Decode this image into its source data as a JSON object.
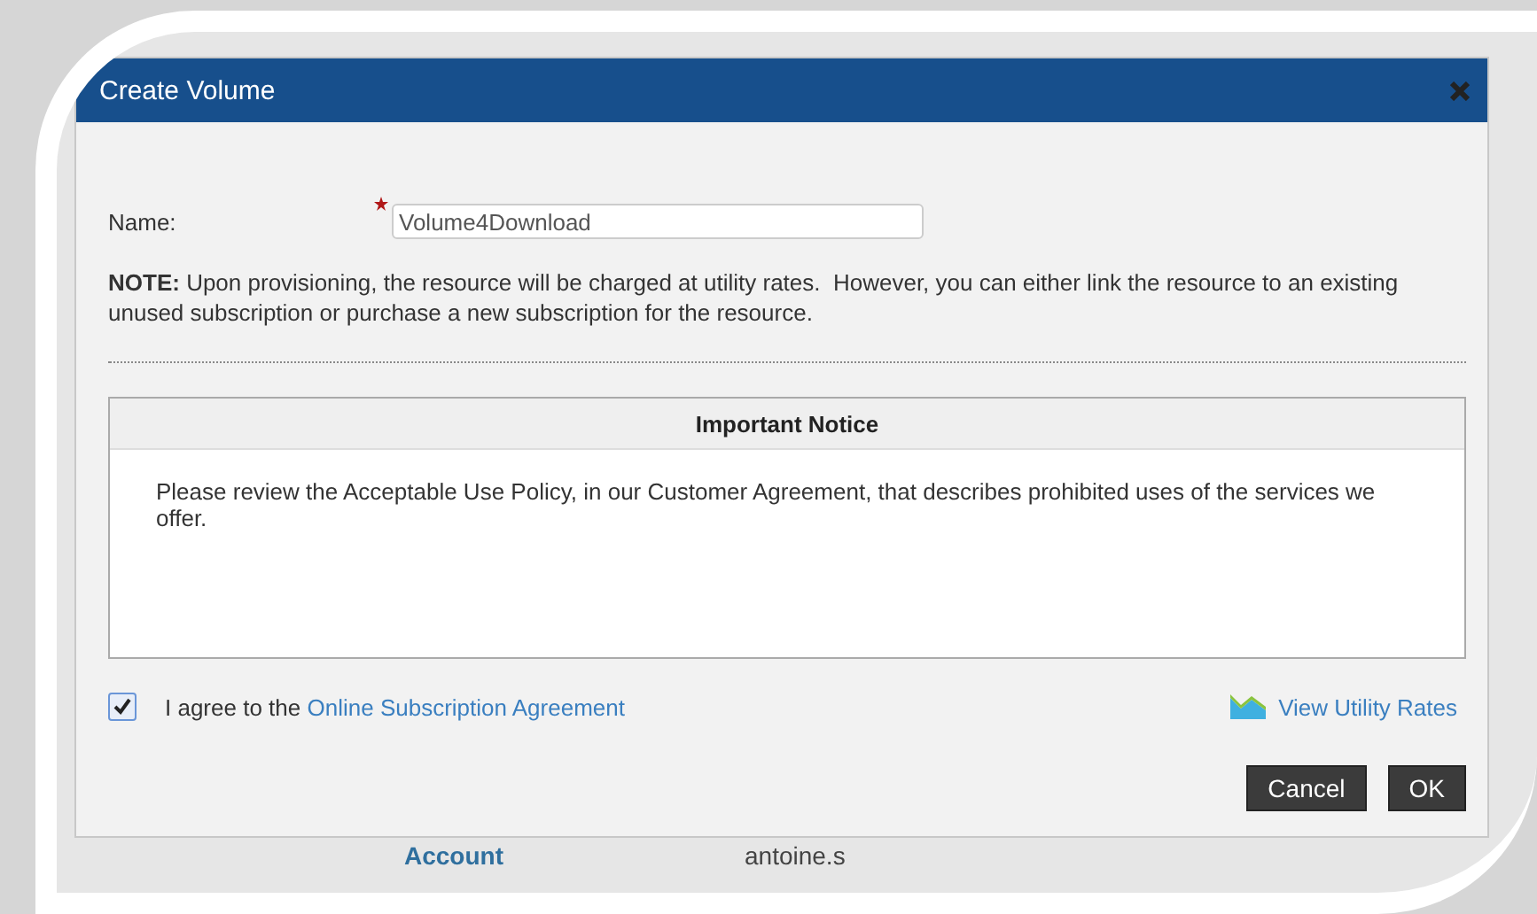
{
  "dialog": {
    "title": "Create Volume"
  },
  "name_field": {
    "label": "Name:",
    "required": true,
    "value": "Volume4Download"
  },
  "note": "**NOTE:** Upon provisioning, the resource will be charged at utility rates.  However, you can either link the resource to an existing unused subscription or purchase a new subscription for the resource.",
  "notice": {
    "title": "Important Notice",
    "text": "Please review the Acceptable Use Policy, in our Customer Agreement, that describes prohibited uses of the services we offer."
  },
  "agreement": {
    "checked": true,
    "text": "I agree to the",
    "link": "Online Subscription Agreement"
  },
  "rates_link": "View Utility Rates",
  "buttons": [
    "Cancel",
    "OK"
  ],
  "background_row": {
    "column_1": "Account",
    "column_2": "antoine.s"
  }
}
